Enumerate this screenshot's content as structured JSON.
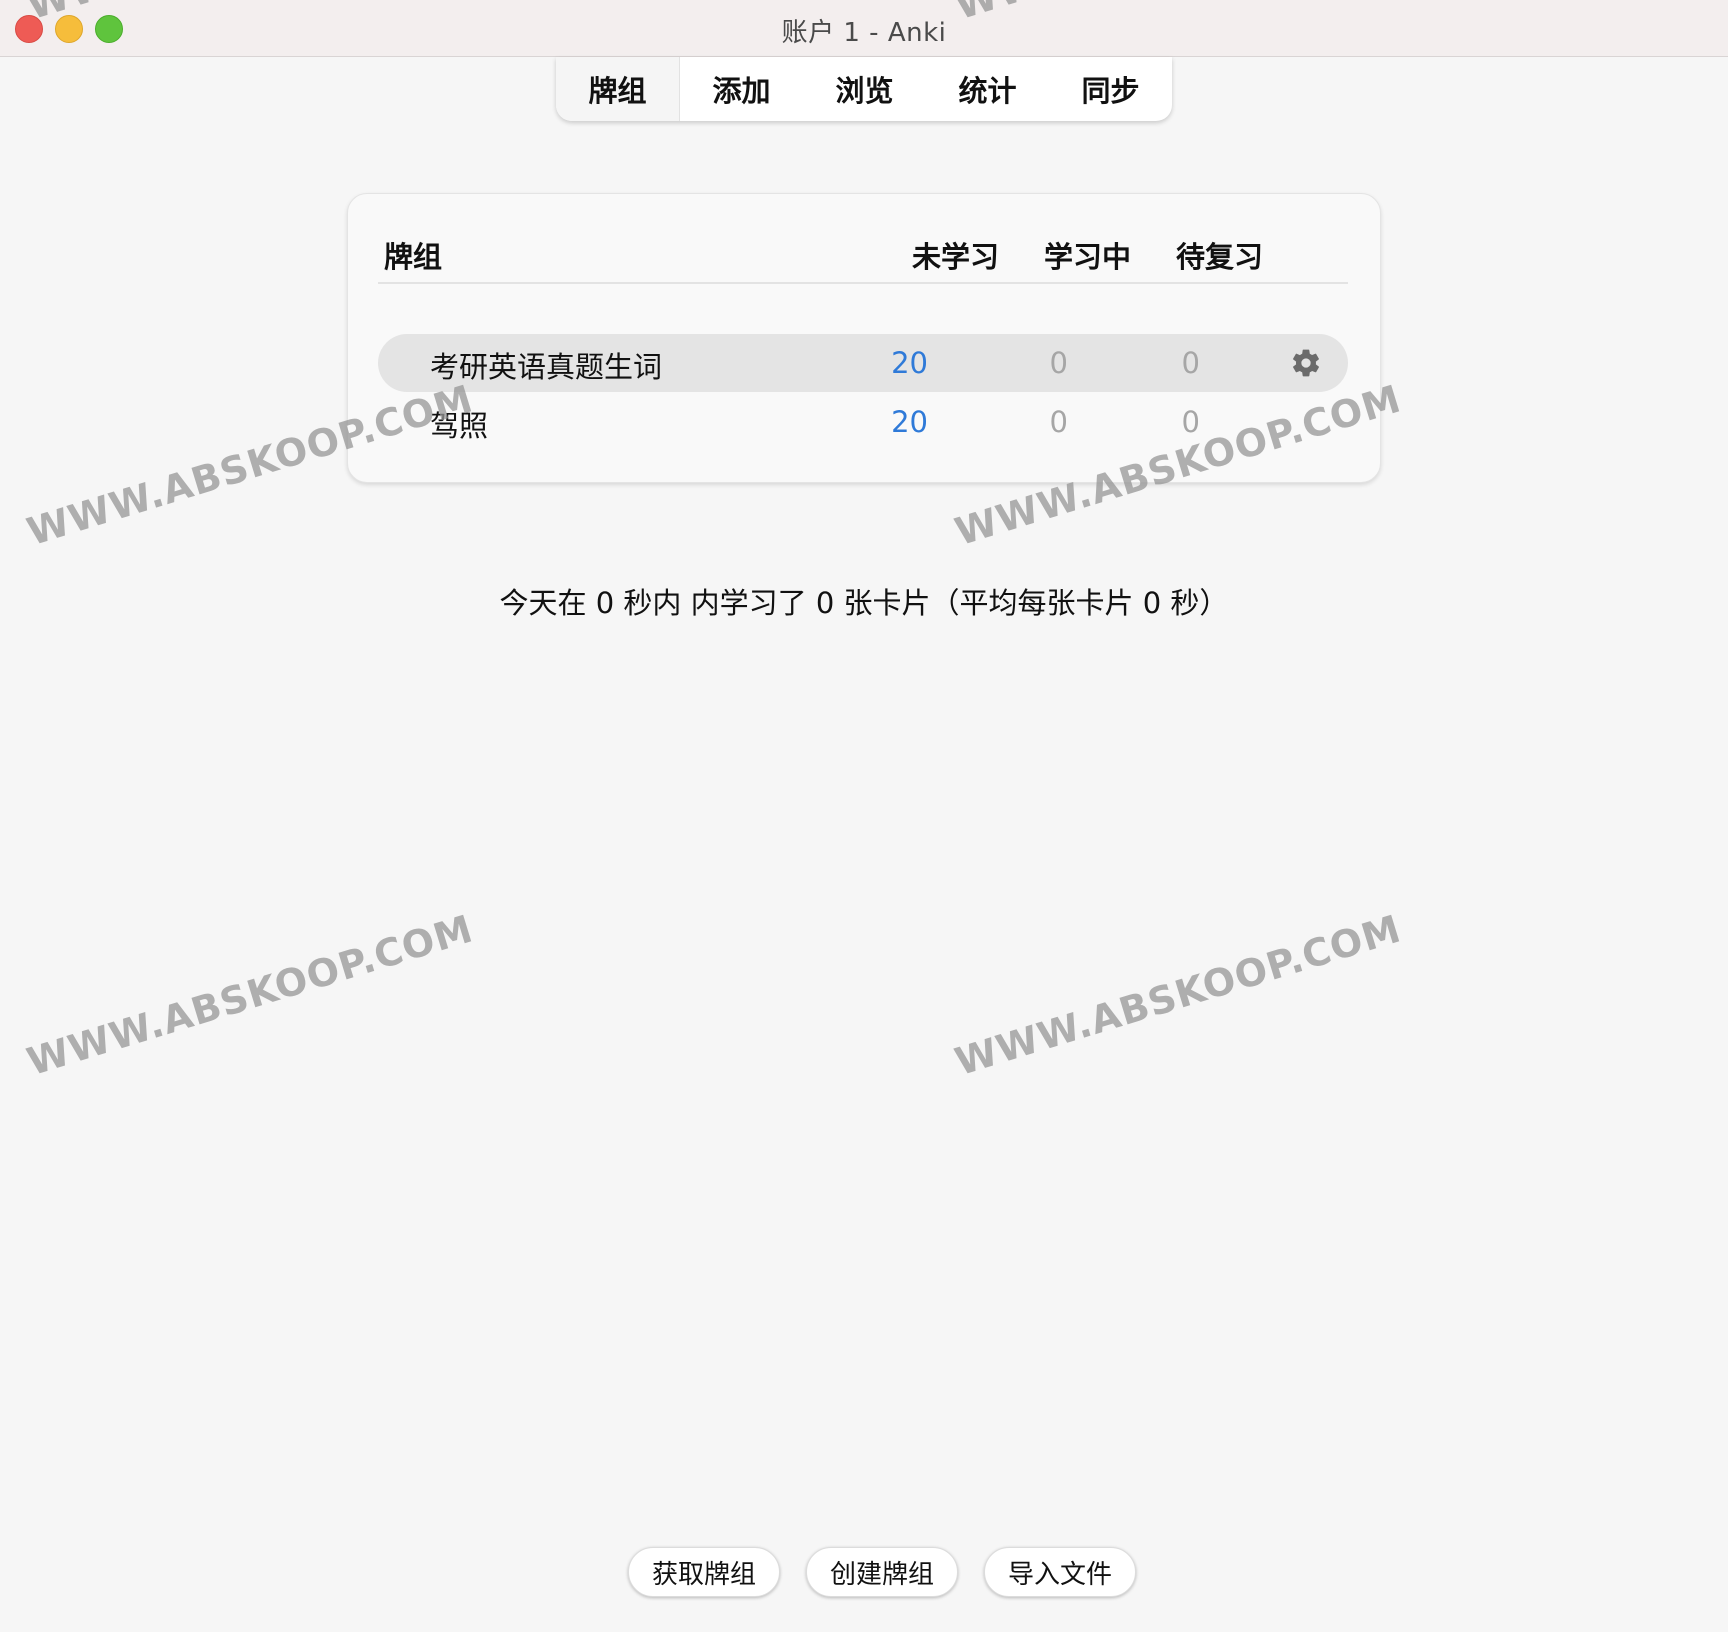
{
  "window": {
    "title": "账户 1 - Anki"
  },
  "toolbar": {
    "tabs": [
      {
        "label": "牌组"
      },
      {
        "label": "添加"
      },
      {
        "label": "浏览"
      },
      {
        "label": "统计"
      },
      {
        "label": "同步"
      }
    ],
    "active": "牌组"
  },
  "deck_table": {
    "headers": {
      "deck": "牌组",
      "new": "未学习",
      "learning": "学习中",
      "review": "待复习"
    },
    "rows": [
      {
        "name": "考研英语真题生词",
        "new": "20",
        "learning": "0",
        "review": "0",
        "selected": true
      },
      {
        "name": "驾照",
        "new": "20",
        "learning": "0",
        "review": "0",
        "selected": false
      }
    ]
  },
  "summary": "今天在 0 秒内 内学习了 0 张卡片（平均每张卡片 0 秒）",
  "bottom_buttons": {
    "get_decks": "获取牌组",
    "create_deck": "创建牌组",
    "import_file": "导入文件"
  },
  "watermark": "WWW.ABSKOOP.COM",
  "colors": {
    "new_count": "#2f7ad8",
    "zero_count": "#a6a6a6",
    "selected_row": "#e4e4e4"
  },
  "icons": {
    "deck_options": "gear-icon"
  }
}
